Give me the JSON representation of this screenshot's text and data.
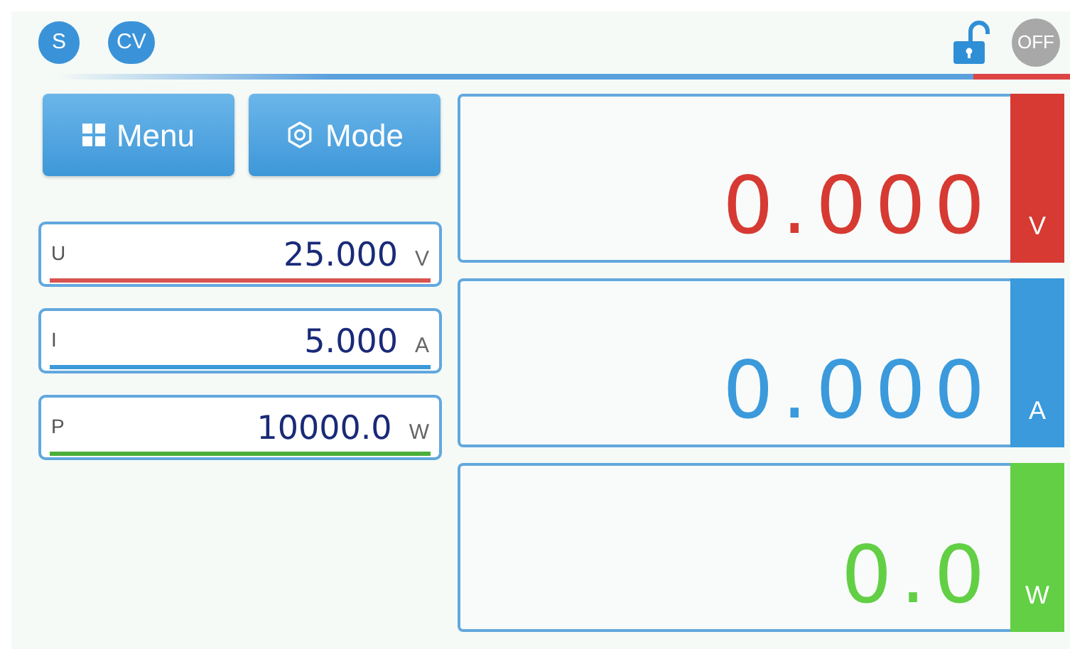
{
  "status": {
    "badges": [
      {
        "label": "S"
      },
      {
        "label": "CV"
      }
    ],
    "locked": false,
    "power": {
      "label": "OFF",
      "on": false
    }
  },
  "buttons": [
    {
      "label": "Menu",
      "kind": "grid"
    },
    {
      "label": "Mode",
      "kind": "gear"
    }
  ],
  "setpoints": [
    {
      "name": "U",
      "value": "25.000",
      "unit": "V",
      "color": "#d9534f"
    },
    {
      "name": "I",
      "value": "5.000",
      "unit": "A",
      "color": "#3b9ad9"
    },
    {
      "name": "P",
      "value": "10000.0",
      "unit": "W",
      "color": "#4caf3a"
    }
  ],
  "readouts": [
    {
      "value": "0.000",
      "unit": "V",
      "color": "#d63a32"
    },
    {
      "value": "0.000",
      "unit": "A",
      "color": "#3a9adb"
    },
    {
      "value": "0.0",
      "unit": "W",
      "color": "#62cf45"
    }
  ]
}
